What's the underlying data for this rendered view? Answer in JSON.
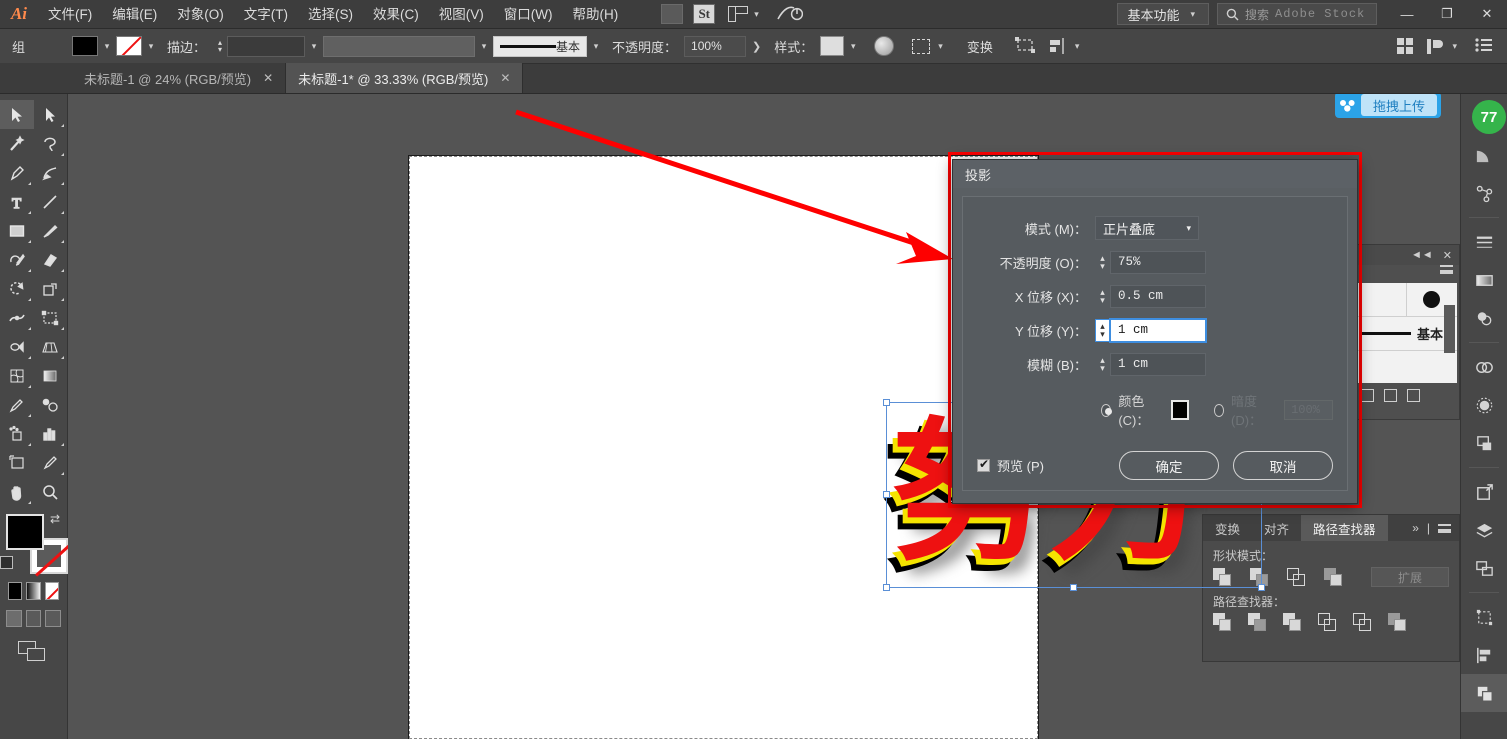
{
  "app": {
    "logo": "Ai"
  },
  "menubar": {
    "items": [
      "文件(F)",
      "编辑(E)",
      "对象(O)",
      "文字(T)",
      "选择(S)",
      "效果(C)",
      "视图(V)",
      "窗口(W)",
      "帮助(H)"
    ],
    "stock_button": "St",
    "workspace": "基本功能",
    "search_placeholder": "搜索",
    "search_source": "Adobe Stock",
    "window_buttons": {
      "minimize": "—",
      "restore": "❐",
      "close": "✕"
    }
  },
  "controlbar": {
    "group_label": "组",
    "stroke_label": "描边：",
    "stroke_weight": "",
    "profile_name": "基本",
    "opacity_label": "不透明度：",
    "opacity_value": "100%",
    "style_label": "样式：",
    "transform_label": "变换"
  },
  "tabs": [
    {
      "title": "未标题-1 @ 24% (RGB/预览)",
      "close": "✕",
      "active": false
    },
    {
      "title": "未标题-1* @ 33.33% (RGB/预览)",
      "close": "✕",
      "active": true
    }
  ],
  "canvas": {
    "artwork_text": "努力",
    "upload_button": "拖拽上传"
  },
  "brush_panel": {
    "name": "基本"
  },
  "pathfinder": {
    "tabs": [
      "变换",
      "对齐",
      "路径查找器"
    ],
    "active_tab": "路径查找器",
    "shape_modes_label": "形状模式：",
    "pathfinders_label": "路径查找器：",
    "expand_button": "扩展"
  },
  "rail": {
    "badge": "77"
  },
  "dialog": {
    "title": "投影",
    "mode_label": "模式 (M)：",
    "mode_value": "正片叠底",
    "opacity_label": "不透明度 (O)：",
    "opacity_value": "75%",
    "x_offset_label": "X 位移 (X)：",
    "x_offset_value": "0.5 cm",
    "y_offset_label": "Y 位移 (Y)：",
    "y_offset_value": "1 cm",
    "blur_label": "模糊 (B)：",
    "blur_value": "1 cm",
    "color_label": "颜色 (C)：",
    "color_value": "#000000",
    "darkness_label": "暗度 (D)：",
    "darkness_value": "100%",
    "preview_label": "预览 (P)",
    "ok_button": "确定",
    "cancel_button": "取消"
  },
  "colors": {
    "accent_red": "#fe0000",
    "focus_blue": "#3e8ee0",
    "artwork_red": "#ee1111",
    "artwork_yellow": "#f5e400",
    "upload_blue": "#2ba3e8"
  }
}
